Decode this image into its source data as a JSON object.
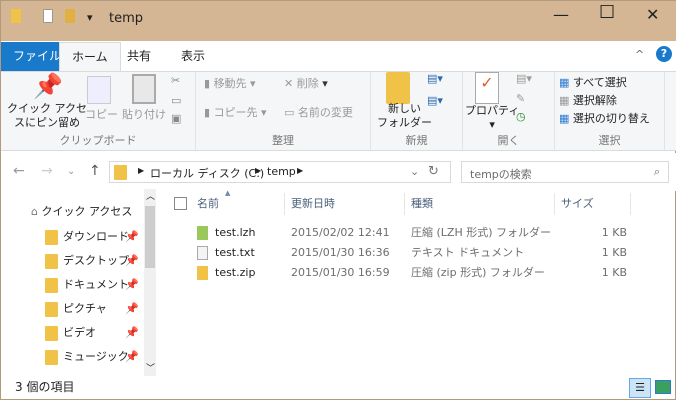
{
  "window": {
    "title": "temp",
    "controls": [
      "minimize",
      "maximize",
      "close"
    ]
  },
  "tabs": [
    {
      "label": "ファイル"
    },
    {
      "label": "ホーム"
    },
    {
      "label": "共有"
    },
    {
      "label": "表示"
    }
  ],
  "ribbon": {
    "clipboard": {
      "label": "クリップボード",
      "pin": "クイック アクセ\nスにピン留め",
      "copy": "コピー",
      "paste": "貼り付け"
    },
    "organize": {
      "label": "整理",
      "move": "移動先",
      "copyto": "コピー先",
      "delete": "削除",
      "rename": "名前の変更"
    },
    "new": {
      "label": "新規",
      "folder": "新しい\nフォルダー"
    },
    "open": {
      "label": "開く",
      "properties": "プロパティ"
    },
    "select": {
      "label": "選択",
      "all": "すべて選択",
      "none": "選択解除",
      "invert": "選択の切り替え"
    }
  },
  "address": {
    "path": [
      "ローカル ディスク (C:)",
      "temp"
    ],
    "search_placeholder": "tempの検索"
  },
  "nav": {
    "quick": "クイック アクセス",
    "items": [
      "ダウンロード",
      "デスクトップ",
      "ドキュメント",
      "ピクチャ",
      "ビデオ",
      "ミュージック"
    ]
  },
  "columns": [
    "名前",
    "更新日時",
    "種類",
    "サイズ"
  ],
  "files": [
    {
      "name": "test.lzh",
      "date": "2015/02/02 12:41",
      "type": "圧縮 (LZH 形式) フォルダー",
      "size": "1 KB",
      "icon": "lzh-archive-icon"
    },
    {
      "name": "test.txt",
      "date": "2015/01/30 16:36",
      "type": "テキスト ドキュメント",
      "size": "1 KB",
      "icon": "text-file-icon"
    },
    {
      "name": "test.zip",
      "date": "2015/01/30 16:59",
      "type": "圧縮 (zip 形式) フォルダー",
      "size": "1 KB",
      "icon": "zip-folder-icon"
    }
  ],
  "status": "3 個の項目",
  "colors": {
    "titlebar": "#d4b594",
    "file_tab": "#1979ca"
  }
}
